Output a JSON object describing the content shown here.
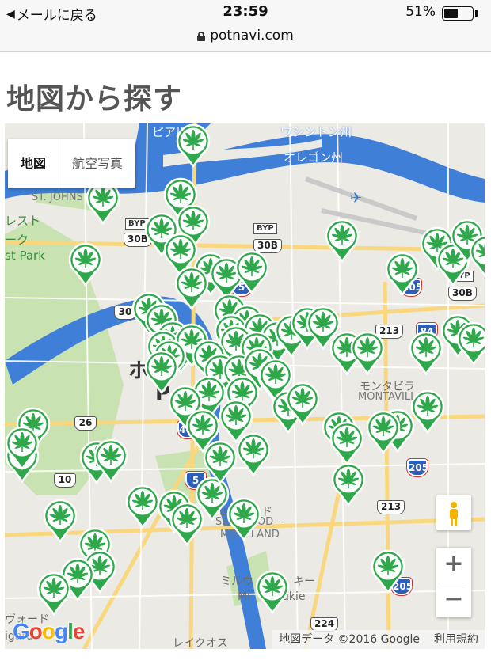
{
  "status_bar": {
    "back_label": "メールに戻る",
    "time": "23:59",
    "battery_percent_label": "51%",
    "battery_level": 0.51
  },
  "url_bar": {
    "url": "potnavi.com"
  },
  "page": {
    "title": "地図から探す"
  },
  "map": {
    "map_type_buttons": [
      "地図",
      "航空写真"
    ],
    "labels": [
      "ワシントン州",
      "オレゴン州",
      "レスト",
      "ーク",
      "st Park",
      "ST. JOHNS",
      "ホ",
      "ト",
      "P",
      "モンタビラ",
      "MONTAVILLA",
      "セルウッド",
      "SELLWOOD -",
      "MORELAND",
      "ミルウ",
      "キー",
      "Mi",
      "ukie",
      "ヴォード",
      "igard",
      "レイクオス",
      "ピア川"
    ],
    "highways": [
      "30B",
      "30B",
      "30B",
      "30",
      "26",
      "10",
      "213",
      "213",
      "224"
    ],
    "byp_labels": [
      "BYP",
      "BYP",
      "BYP"
    ],
    "interstates": [
      "205",
      "205",
      "205",
      "84",
      "5",
      "5",
      "405"
    ],
    "zoom_in": "+",
    "zoom_out": "−",
    "google_logo": "Google",
    "attribution": "地図データ ©2016 Google",
    "terms": "利用規約",
    "pin_count": 78,
    "colors": {
      "pin": "#2ea84a",
      "water": "#3f7fd8",
      "park": "#c8e2b1",
      "road": "#f9d77e"
    }
  }
}
